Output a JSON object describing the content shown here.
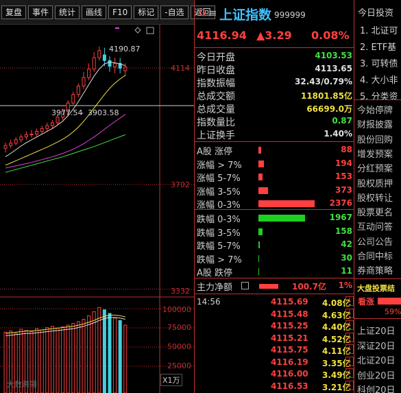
{
  "toolbar": {
    "buttons": [
      "复盘",
      "事件",
      "统计",
      "画线",
      "F10",
      "标记",
      "-自选",
      "返回"
    ]
  },
  "chart": {
    "price_axis": [
      "4114",
      "3702",
      "3332"
    ],
    "volume_axis": [
      "100000",
      "75000",
      "50000",
      "25000"
    ],
    "volume_unit": "X1万",
    "high_label": "4190.87",
    "ma_text_1": "3977.54",
    "ma_text_2": "3903.58",
    "watermark": "大数跨领"
  },
  "chart_data": {
    "type": "candlestick",
    "price_ticks": [
      4114,
      3702,
      3332
    ],
    "volume_ticks": [
      100000,
      75000,
      50000,
      25000
    ],
    "volume_unit": "X1万",
    "annotations": [
      "4190.87",
      "3977.54",
      "3903.58"
    ]
  },
  "quote": {
    "flag": "G",
    "menu_icon": "≡",
    "name": "上证指数",
    "code": "999999",
    "price": "4116.94",
    "change": "▲3.29",
    "pct": "0.08%",
    "stats": [
      {
        "label": "今日开盘",
        "value": "4103.53",
        "color": "#40e040"
      },
      {
        "label": "昨日收盘",
        "value": "4113.65",
        "color": "#e0e0e0"
      },
      {
        "label": "指数振幅",
        "value": "32.43/0.79%",
        "color": "#e0e0e0"
      },
      {
        "label": "总成交额",
        "value": "11801.85亿",
        "color": "#f0e040"
      },
      {
        "label": "总成交量",
        "value": "66699.0万",
        "color": "#f0e040"
      },
      {
        "label": "指数量比",
        "value": "0.87",
        "color": "#40e040"
      },
      {
        "label": "上证换手",
        "value": "1.40%",
        "color": "#e0e0e0"
      }
    ],
    "rise": [
      {
        "label": "A股 涨停",
        "value": "88",
        "bar": 4
      },
      {
        "label": "涨幅 > 7%",
        "value": "194",
        "bar": 8
      },
      {
        "label": "涨幅 5-7%",
        "value": "153",
        "bar": 6
      },
      {
        "label": "涨幅 3-5%",
        "value": "373",
        "bar": 14
      },
      {
        "label": "涨幅 0-3%",
        "value": "2376",
        "bar": 82
      }
    ],
    "fall": [
      {
        "label": "跌幅 0-3%",
        "value": "1967",
        "bar": 68
      },
      {
        "label": "跌幅 3-5%",
        "value": "158",
        "bar": 6
      },
      {
        "label": "跌幅 5-7%",
        "value": "42",
        "bar": 2
      },
      {
        "label": "跌幅 > 7%",
        "value": "30",
        "bar": 1
      },
      {
        "label": "A股 跌停",
        "value": "11",
        "bar": 1
      }
    ],
    "flow": {
      "label": "主力净额",
      "value": "100.7亿",
      "pct": "1%"
    },
    "ticks": [
      {
        "time": "14:56",
        "price": "4115.69",
        "vol": "4.08亿",
        "flag": "↓"
      },
      {
        "time": "",
        "price": "4115.48",
        "vol": "4.63亿",
        "flag": "↓"
      },
      {
        "time": "",
        "price": "4115.25",
        "vol": "4.40亿",
        "flag": "↓"
      },
      {
        "time": "",
        "price": "4115.21",
        "vol": "4.52亿",
        "flag": "↓"
      },
      {
        "time": "",
        "price": "4115.75",
        "vol": "4.11亿",
        "flag": "↓"
      },
      {
        "time": "",
        "price": "4116.19",
        "vol": "3.35亿",
        "flag": "↓"
      },
      {
        "time": "",
        "price": "4116.00",
        "vol": "3.49亿",
        "flag": "↓"
      },
      {
        "time": "",
        "price": "4116.53",
        "vol": "3.21亿",
        "flag": "↓"
      }
    ]
  },
  "right": {
    "title": "今日投资",
    "news": [
      "1. 北证可",
      "2. ETF基",
      "3. 可转债",
      "4. 大小非",
      "5. 分类资"
    ],
    "menu": [
      "今始停牌",
      "财报披露",
      "股份回购",
      "增发预案",
      "分红预案",
      "股权质押",
      "股权转让",
      "股票更名",
      "互动问答",
      "公司公告",
      "合同中标",
      "券商策略"
    ],
    "vote_title": "大盘投票结",
    "vote_up": "看涨",
    "vote_pct": "59%",
    "sub": [
      "上证20日",
      "深证20日",
      "北证20日",
      "创业20日",
      "科创20日"
    ]
  }
}
